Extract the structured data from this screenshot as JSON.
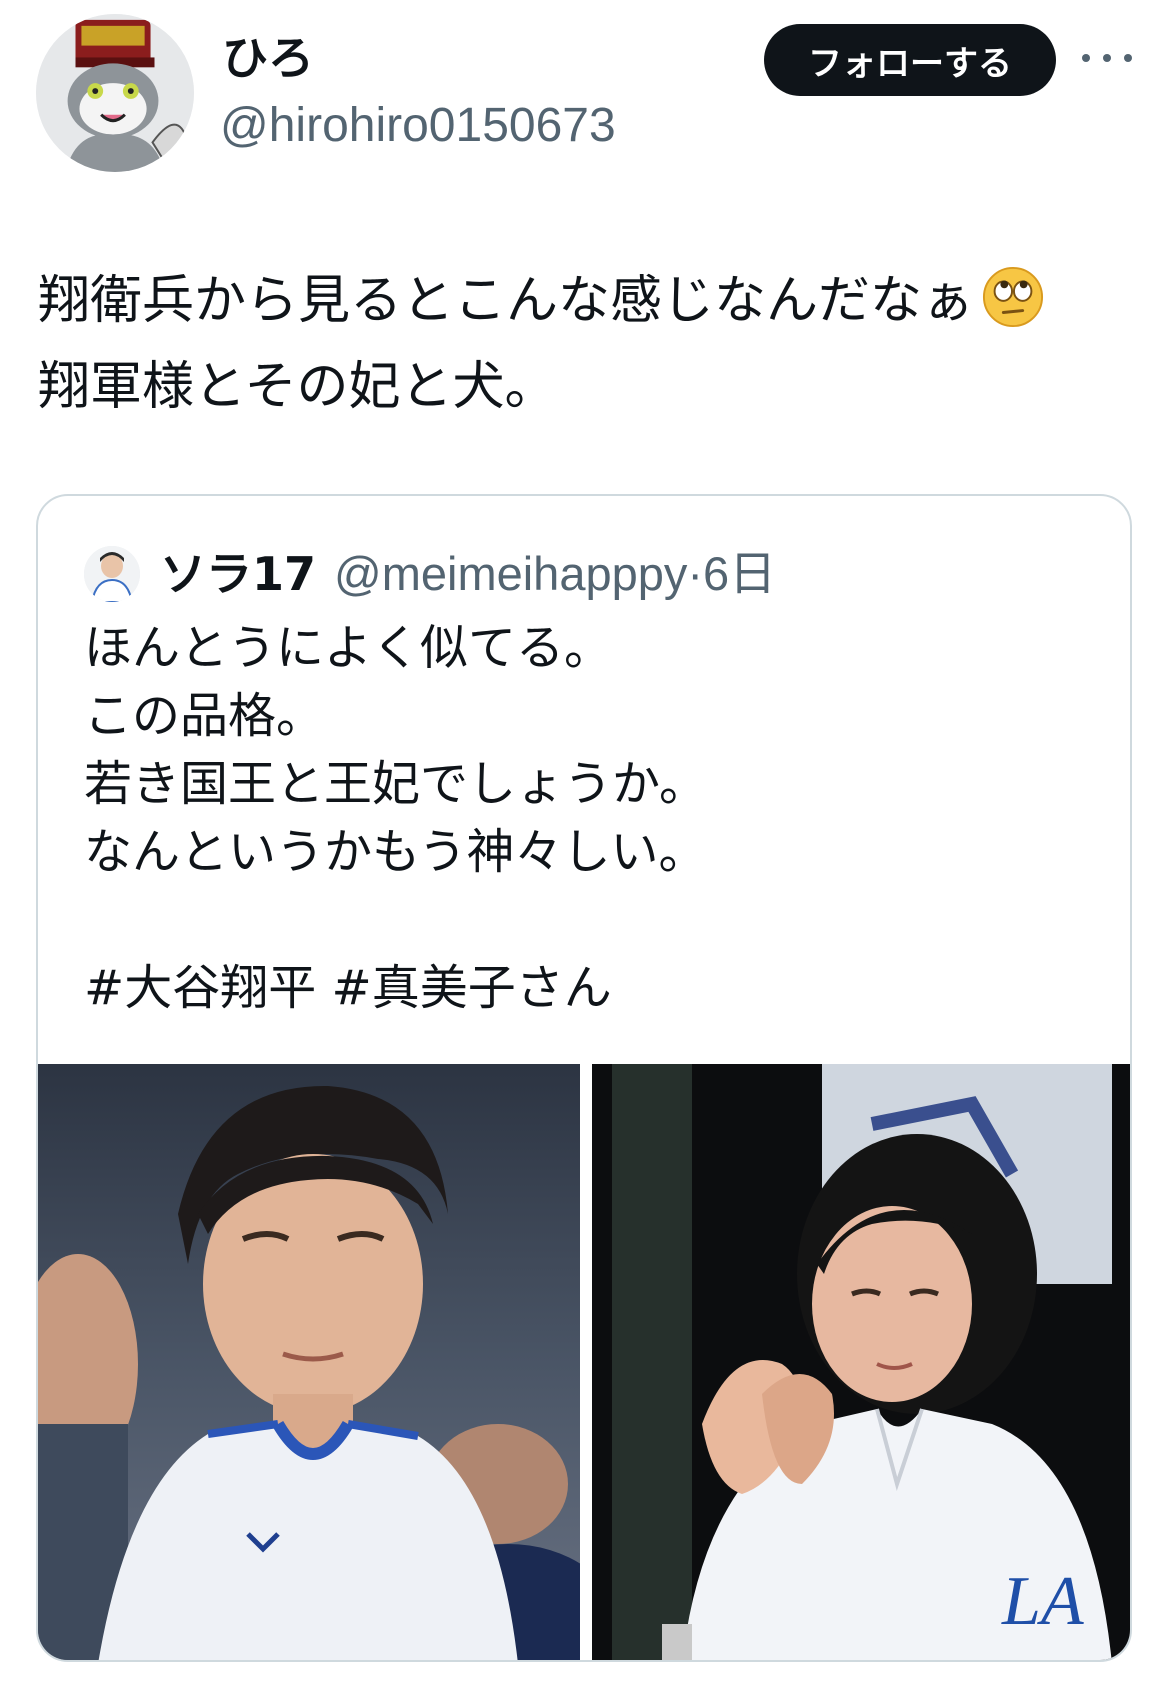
{
  "author": {
    "display_name": "ひろ",
    "handle": "@hirohiro0150673",
    "avatar_icon": "cat-mascot-avatar"
  },
  "follow_button_label": "フォローする",
  "more_icon": "more-horizontal-icon",
  "tweet": {
    "lines": [
      "翔衛兵から見るとこんな感じなんだなぁ",
      "翔軍様とその妃と犬。"
    ],
    "emoji": "face-with-rolling-eyes-emoji"
  },
  "quoted_tweet": {
    "display_name": "ソラ17",
    "handle": "@meimeihapppy",
    "separator": "·",
    "time": "6日",
    "lines": [
      "ほんとうによく似てる。",
      "この品格。",
      "若き国王と王妃でしょうか。",
      "なんというかもう神々しい。",
      "",
      "#大谷翔平 #真美子さん"
    ],
    "media": [
      {
        "name": "photo-baseball-player"
      },
      {
        "name": "photo-woman-clapping"
      }
    ]
  },
  "colors": {
    "text_primary": "#0f1419",
    "text_secondary": "#536471",
    "border": "#cfd9de",
    "button_bg": "#0f1419",
    "button_text": "#ffffff"
  }
}
